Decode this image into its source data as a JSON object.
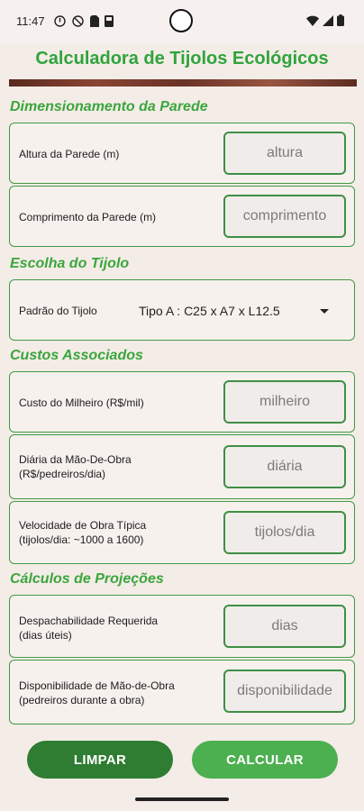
{
  "status_bar": {
    "time": "11:47"
  },
  "app": {
    "title": "Calculadora de Tijolos Ecológicos"
  },
  "sections": {
    "dimensions": "Dimensionamento da Parede",
    "brick": "Escolha do Tijolo",
    "costs": "Custos Associados",
    "projections": "Cálculos de Projeções"
  },
  "fields": {
    "height": {
      "label": "Altura da Parede (m)",
      "placeholder": "altura",
      "value": ""
    },
    "length": {
      "label": "Comprimento da Parede (m)",
      "placeholder": "comprimento",
      "value": ""
    },
    "thousand_cost": {
      "label": "Custo do Milheiro (R$/mil)",
      "placeholder": "milheiro",
      "value": ""
    },
    "daily_labor": {
      "label1": "Diária da Mão-De-Obra",
      "label2": "(R$/pedreiros/dia)",
      "placeholder": "diária",
      "value": ""
    },
    "work_speed": {
      "label1": "Velocidade de Obra Típica",
      "label2": "(tijolos/dia: ~1000 a 1600)",
      "placeholder": "tijolos/dia",
      "value": ""
    },
    "dispatch": {
      "label1": "Despachabilidade Requerida",
      "label2": "(dias úteis)",
      "placeholder": "dias",
      "value": ""
    },
    "availability": {
      "label1": "Disponibilidade de Mão-de-Obra",
      "label2": "(pedreiros durante a obra)",
      "placeholder": "disponibilidade",
      "value": ""
    }
  },
  "brick": {
    "label": "Padrão do Tijolo",
    "selected": "Tipo A : C25 x A7  x L12.5"
  },
  "buttons": {
    "clear": "LIMPAR",
    "calculate": "CALCULAR"
  },
  "colors": {
    "accent": "#3aa63c",
    "button_dark": "#2e7d32",
    "button_light": "#4caf50",
    "border": "#3f9a45"
  }
}
